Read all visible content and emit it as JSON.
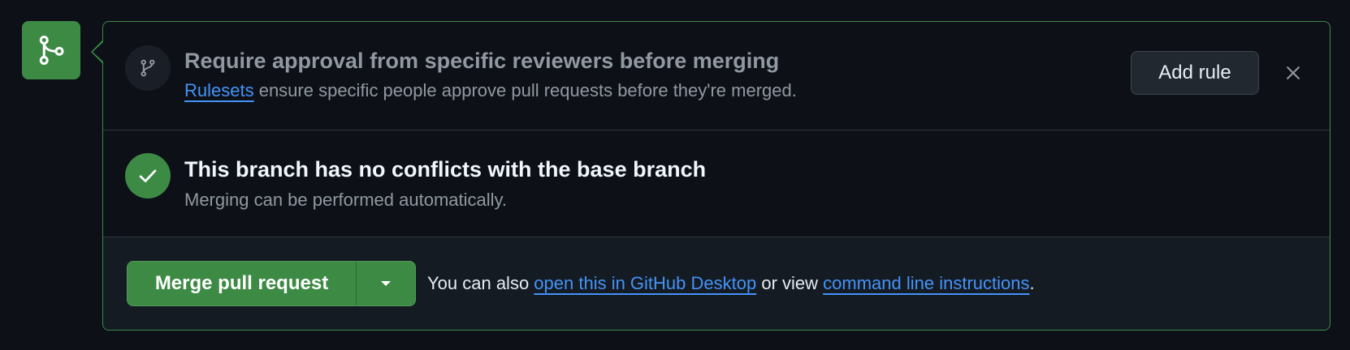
{
  "colors": {
    "accent_green": "#3d8a45",
    "link_blue": "#4493f8",
    "background": "#0d1117"
  },
  "header_icon": "git-merge-icon",
  "reviewers": {
    "icon": "git-branch-icon",
    "title": "Require approval from specific reviewers before merging",
    "rulesets_link": "Rulesets",
    "description_rest": " ensure specific people approve pull requests before they're merged.",
    "add_rule_label": "Add rule",
    "close_icon": "x-icon"
  },
  "conflicts": {
    "icon": "check-icon",
    "title": "This branch has no conflicts with the base branch",
    "subtitle": "Merging can be performed automatically."
  },
  "merge": {
    "button_label": "Merge pull request",
    "dropdown_icon": "triangle-down-icon",
    "also_prefix": "You can also ",
    "desktop_link": "open this in GitHub Desktop",
    "middle_text": " or view ",
    "cli_link": "command line instructions",
    "suffix": "."
  }
}
